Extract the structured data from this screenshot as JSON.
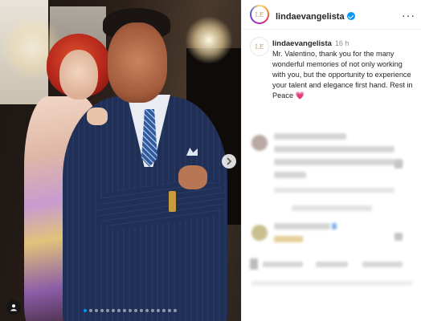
{
  "post": {
    "username": "lindaevangelista",
    "time": "16 h",
    "caption": "Mr. Valentino, thank you for the many wonderful memories of not only working with you, but the opportunity to experience your talent and elegance first hand. Rest in Peace",
    "caption_emoji": "💗",
    "more_label": "···",
    "avatar_logo": "LE"
  },
  "carousel": {
    "dots": 17,
    "active_index": 0
  },
  "icons": {
    "next": "chevron-right-icon",
    "tag": "person-tag-icon",
    "verified": "verified-badge-icon",
    "more": "more-options-icon"
  },
  "colors": {
    "accent": "#0095f6",
    "heart": "#e6398a"
  }
}
